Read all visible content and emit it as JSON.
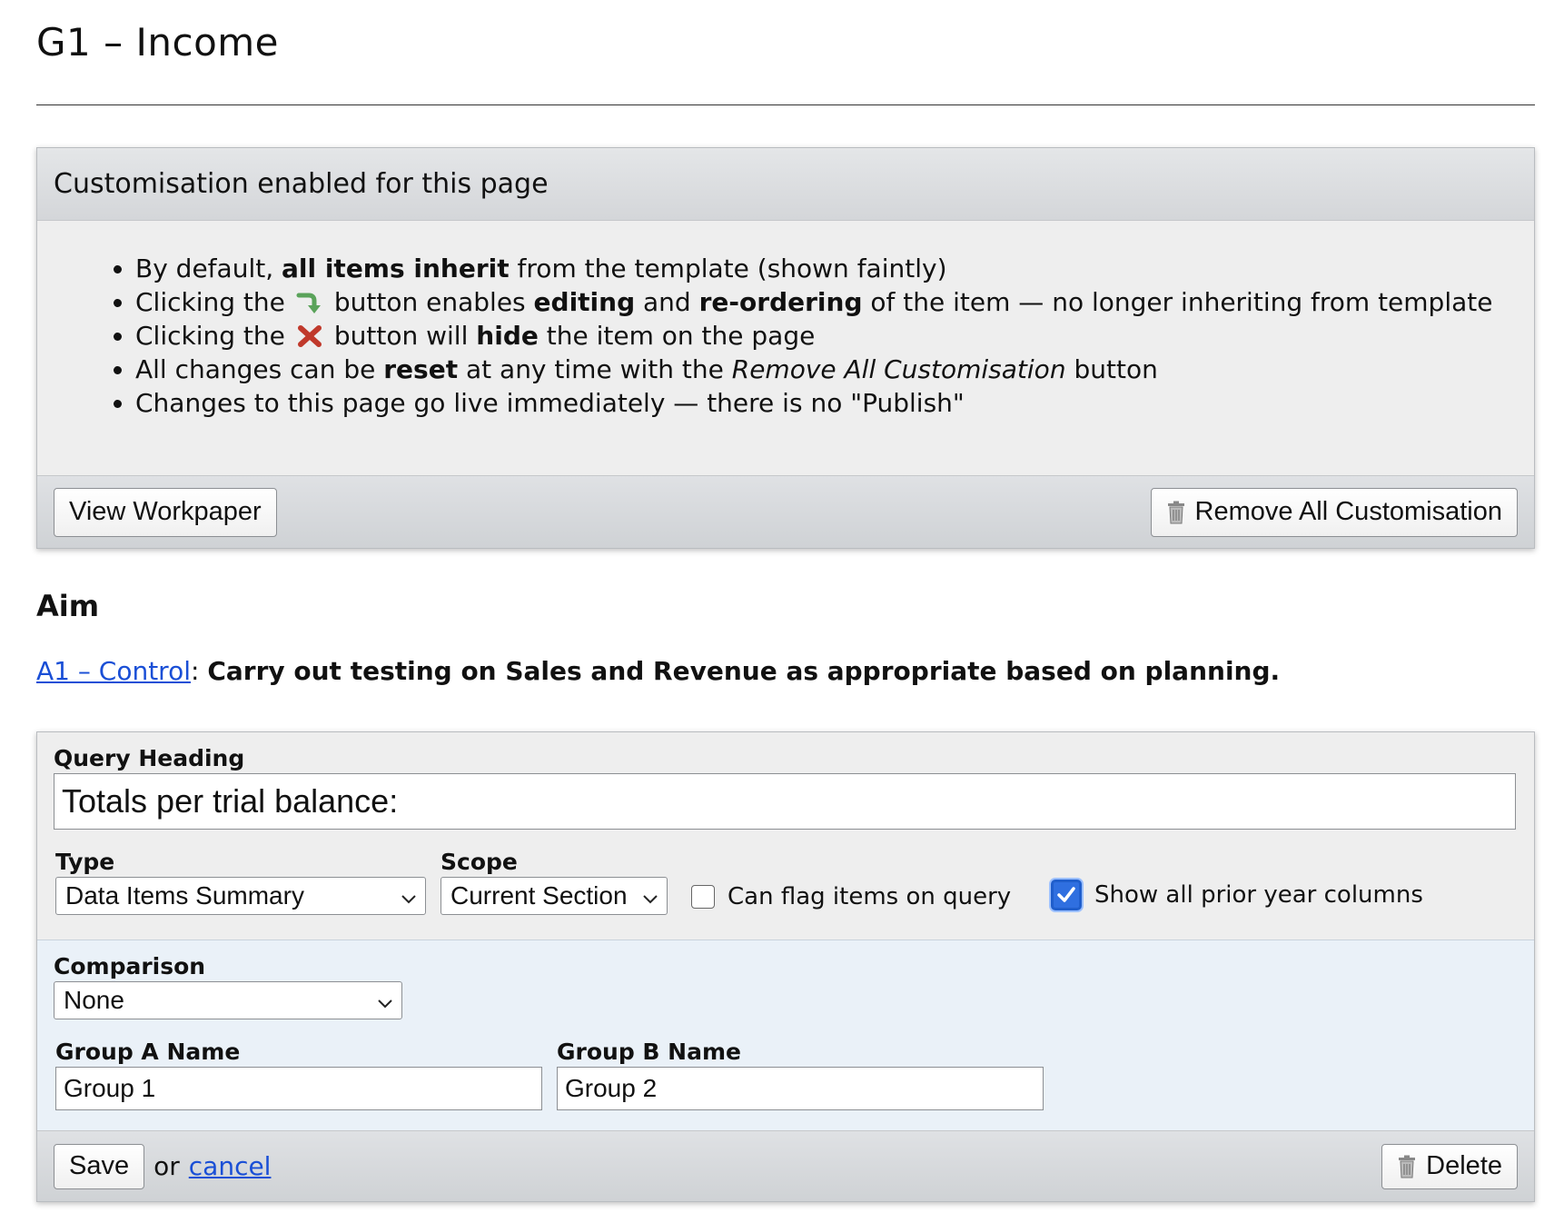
{
  "page": {
    "title": "G1 – Income"
  },
  "customisation": {
    "header": "Customisation enabled for this page",
    "bullets": {
      "b1_pre": "By default, ",
      "b1_bold": "all items inherit",
      "b1_post": " from the template (shown faintly)",
      "b2_pre": "Clicking the",
      "b2_mid1": "button enables ",
      "b2_bold1": "editing",
      "b2_mid2": " and ",
      "b2_bold2": "re-ordering",
      "b2_post": " of the item — no longer inheriting from template",
      "b3_pre": "Clicking the",
      "b3_mid": "button will ",
      "b3_bold": "hide",
      "b3_post": " the item on the page",
      "b4_pre": "All changes can be ",
      "b4_bold": "reset",
      "b4_mid": " at any time with the ",
      "b4_italic": "Remove All Customisation",
      "b4_post": " button",
      "b5": "Changes to this page go live immediately — there is no \"Publish\""
    },
    "view_workpaper_label": "View Workpaper",
    "remove_all_label": "Remove All Customisation"
  },
  "aim": {
    "heading": "Aim",
    "link_text": "A1 – Control",
    "separator": ":",
    "text": "Carry out testing on Sales and Revenue as appropriate based on planning."
  },
  "query": {
    "heading_label": "Query Heading",
    "heading_value": "Totals per trial balance:",
    "type_label": "Type",
    "type_value": "Data Items Summary",
    "scope_label": "Scope",
    "scope_value": "Current Section",
    "can_flag_label": "Can flag items on query",
    "can_flag_checked": false,
    "show_prior_label": "Show all prior year columns",
    "show_prior_checked": true,
    "comparison_label": "Comparison",
    "comparison_value": "None",
    "group_a_label": "Group A Name",
    "group_a_value": "Group 1",
    "group_b_label": "Group B Name",
    "group_b_value": "Group 2",
    "save_label": "Save",
    "or_text": "or",
    "cancel_label": "cancel",
    "delete_label": "Delete"
  },
  "colors": {
    "link": "#1a4fd6",
    "checkbox_accent": "#2f6fe0",
    "inherit_arrow": "#5aa35a",
    "hide_x": "#c0392b",
    "comparison_bg": "#eaf1f8"
  },
  "icons": {
    "inherit_icon": "curved-arrow-down-right",
    "hide_icon": "red-x",
    "trash_icon": "trash-can",
    "select_chevron": "chevron-down"
  }
}
